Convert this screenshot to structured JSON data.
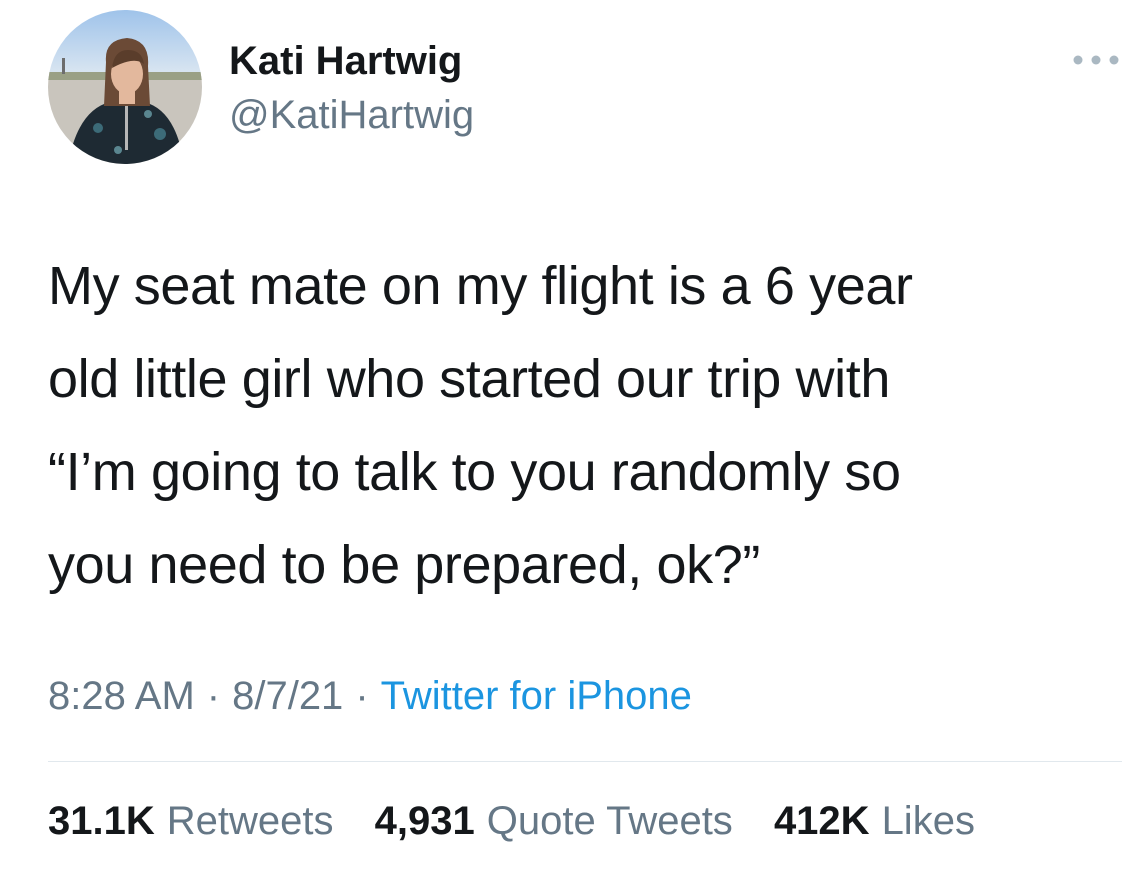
{
  "tweet": {
    "author": {
      "display_name": "Kati Hartwig",
      "handle": "@KatiHartwig",
      "avatar_icon": "user-avatar-photo"
    },
    "more_icon": "more-dots-icon",
    "text_lines": [
      "My seat mate on my flight is a 6 year",
      "old little girl who started our trip with",
      "“I’m going to talk to you randomly so",
      "you need to be prepared, ok?”"
    ],
    "time": "8:28 AM",
    "separator": "·",
    "date": "8/7/21",
    "source": "Twitter for iPhone",
    "stats": {
      "retweets_count": "31.1K",
      "retweets_label": "Retweets",
      "quotes_count": "4,931",
      "quotes_label": "Quote Tweets",
      "likes_count": "412K",
      "likes_label": "Likes"
    }
  },
  "colors": {
    "text": "#14171a",
    "secondary": "#657786",
    "link": "#1b95e0",
    "divider": "#e1e8ed"
  }
}
